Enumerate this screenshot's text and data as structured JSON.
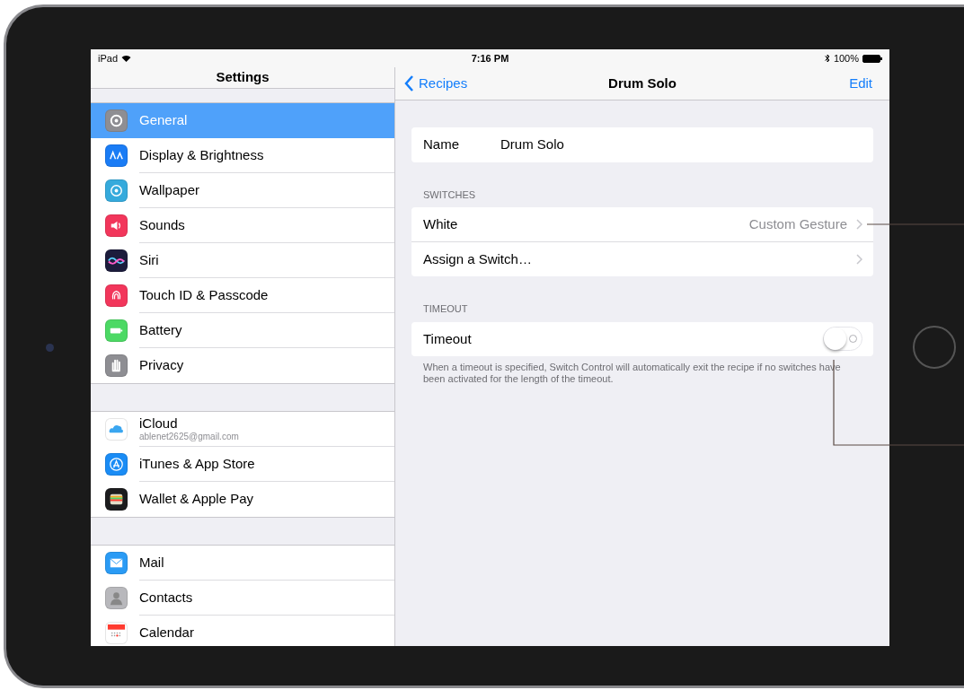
{
  "status_bar": {
    "carrier": "iPad",
    "time": "7:16 PM",
    "battery": "100%"
  },
  "sidebar": {
    "title": "Settings",
    "groups": [
      [
        {
          "label": "General",
          "kind": "gear",
          "color": "#8e8e93",
          "selected": true
        },
        {
          "label": "Display & Brightness",
          "kind": "text",
          "color": "#1a7cf5",
          "selected": false
        },
        {
          "label": "Wallpaper",
          "kind": "flower",
          "color": "#35aadc",
          "selected": false
        },
        {
          "label": "Sounds",
          "kind": "speaker",
          "color": "#f2365b",
          "selected": false
        },
        {
          "label": "Siri",
          "kind": "wave",
          "color": "#1c1c3c",
          "selected": false
        },
        {
          "label": "Touch ID & Passcode",
          "kind": "fingerprint",
          "color": "#f2365b",
          "selected": false
        },
        {
          "label": "Battery",
          "kind": "battery",
          "color": "#4cd964",
          "selected": false
        },
        {
          "label": "Privacy",
          "kind": "hand",
          "color": "#8e8e93",
          "selected": false
        }
      ],
      [
        {
          "label": "iCloud",
          "subtitle": "ablenet2625@gmail.com",
          "kind": "cloud",
          "color": "#ffffff",
          "selected": false
        },
        {
          "label": "iTunes & App Store",
          "kind": "appstore",
          "color": "#1a8cf5",
          "selected": false
        },
        {
          "label": "Wallet & Apple Pay",
          "kind": "wallet",
          "color": "#1c1c1e",
          "selected": false
        }
      ],
      [
        {
          "label": "Mail",
          "kind": "mail",
          "color": "#2a9bf5",
          "selected": false
        },
        {
          "label": "Contacts",
          "kind": "person",
          "color": "#b8b8bc",
          "selected": false
        },
        {
          "label": "Calendar",
          "kind": "calendar",
          "color": "#ffffff",
          "selected": false
        }
      ]
    ]
  },
  "detail": {
    "nav": {
      "back": "Recipes",
      "title": "Drum Solo",
      "action": "Edit"
    },
    "sections": [
      {
        "rows": [
          {
            "kind": "field",
            "label": "Name",
            "value": "Drum Solo"
          }
        ]
      },
      {
        "header": "SWITCHES",
        "rows": [
          {
            "kind": "link",
            "label": "White",
            "value": "Custom Gesture"
          },
          {
            "kind": "link",
            "label": "Assign a Switch…"
          }
        ]
      },
      {
        "header": "TIMEOUT",
        "rows": [
          {
            "kind": "toggle",
            "label": "Timeout",
            "on": false
          }
        ],
        "footer": "When a timeout is specified, Switch Control will automatically exit the recipe if no switches have been activated for the length of the timeout."
      }
    ]
  }
}
